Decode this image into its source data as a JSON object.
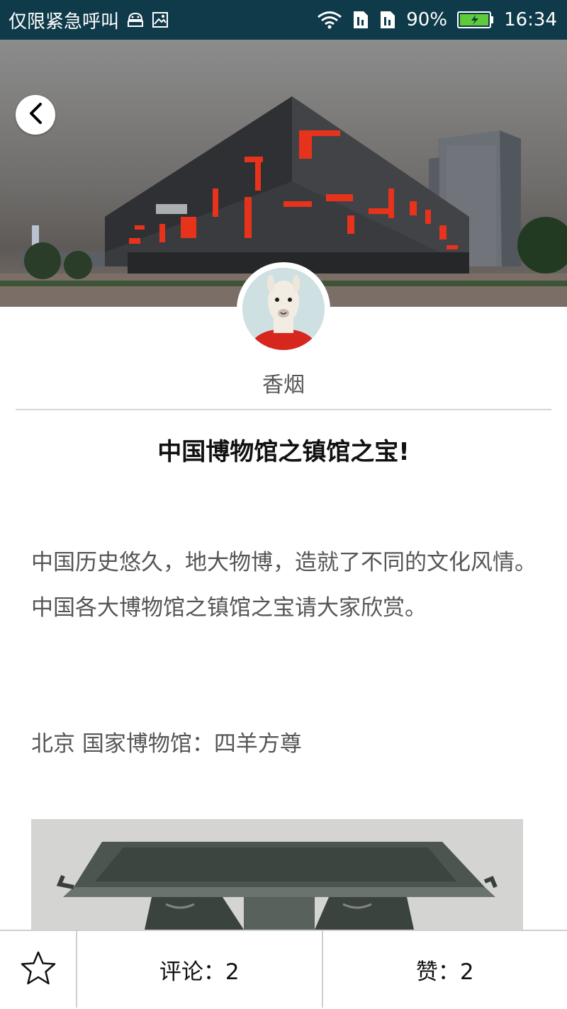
{
  "status_bar": {
    "carrier_text": "仅限紧急呼叫",
    "battery_percent": "90%",
    "time": "16:34"
  },
  "post": {
    "author_name": "香烟",
    "title": "中国博物馆之镇馆之宝!",
    "intro": "中国历史悠久，地大物博，造就了不同的文化风情。中国各大博物馆之镇馆之宝请大家欣赏。",
    "location_line": "北京 国家博物馆：四羊方尊"
  },
  "bottom_bar": {
    "comments_label": "评论：2",
    "likes_label": "赞：2"
  },
  "colors": {
    "status_bar_bg": "#0f3a4a",
    "accent_red": "#e8331c"
  }
}
